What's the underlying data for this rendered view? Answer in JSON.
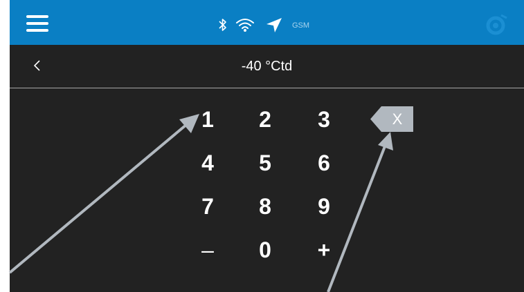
{
  "header": {
    "title": "-40 °Ctd",
    "status_icons": [
      "bluetooth-icon",
      "wifi-icon",
      "location-arrow-icon"
    ],
    "gsm_label": "GSM",
    "accent_color": "#0a7fc4"
  },
  "keypad": {
    "keys": [
      "1",
      "2",
      "3",
      "4",
      "5",
      "6",
      "7",
      "8",
      "9",
      "–",
      "0",
      "+"
    ],
    "backspace_label": "X"
  },
  "colors": {
    "background": "#222222",
    "backspace_fill": "#b1b8bf",
    "annotation_arrow": "#b1b8bf"
  }
}
